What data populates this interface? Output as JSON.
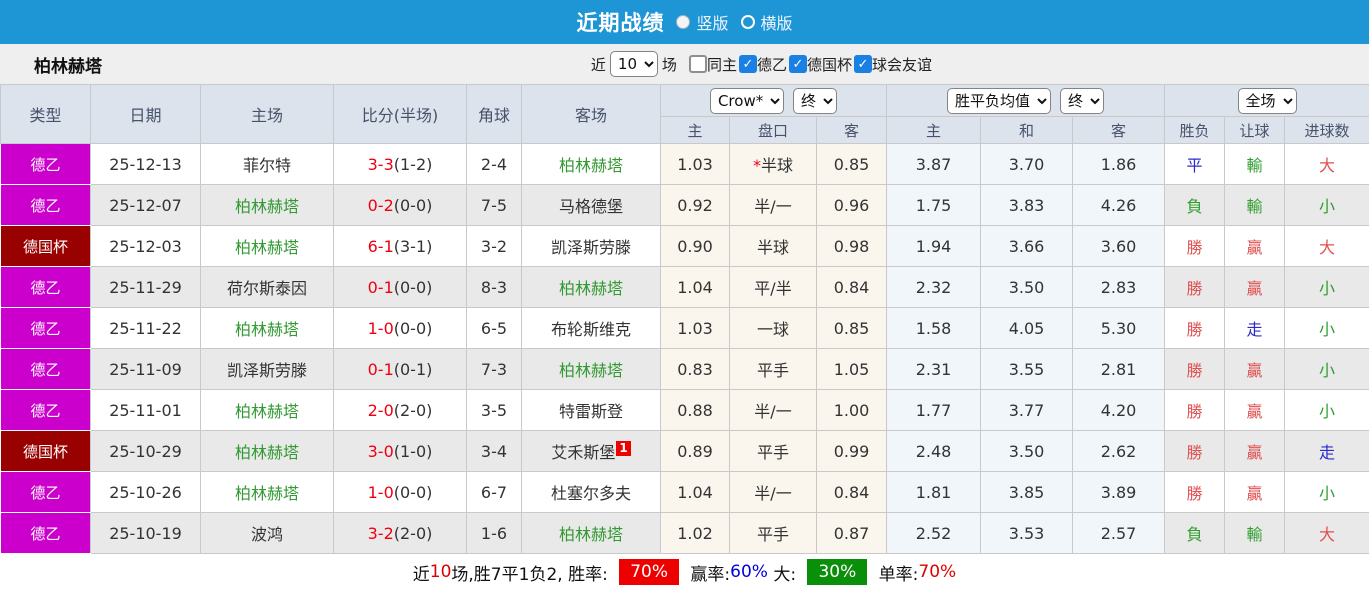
{
  "header": {
    "title": "近期战绩",
    "vertical_label": "竖版",
    "horizontal_label": "横版",
    "selected_layout": "竖版"
  },
  "filters": {
    "team_name": "柏林赫塔",
    "near_label": "近",
    "count": "10",
    "games_label": "场",
    "checkboxes": [
      {
        "label": "同主",
        "checked": false
      },
      {
        "label": "德乙",
        "checked": true
      },
      {
        "label": "德国杯",
        "checked": true
      },
      {
        "label": "球会友谊",
        "checked": true
      }
    ]
  },
  "table": {
    "columns": [
      "类型",
      "日期",
      "主场",
      "比分(半场)",
      "角球",
      "客场"
    ],
    "group1": {
      "select1": "Crow*",
      "select2": "终",
      "subs": [
        "主",
        "盘口",
        "客"
      ]
    },
    "group2": {
      "select1": "胜平负均值",
      "select2": "终",
      "subs": [
        "主",
        "和",
        "客"
      ]
    },
    "group3": {
      "select1": "全场",
      "subs": [
        "胜负",
        "让球",
        "进球数"
      ]
    }
  },
  "palette": {
    "title_bar_blue": "#1e95d5",
    "league_l2_magenta": "#cc00cc",
    "league_cup_dark_red": "#990000",
    "focus_team_green": "#339933",
    "score_red": "#ee0011",
    "result_red": "#e05050",
    "result_blue": "#2b2bcc",
    "result_green": "#2f9e2f",
    "checkbox_blue": "#1b80e4",
    "box_red": "#ee0000",
    "box_green": "#0a8f0a"
  },
  "rows": [
    {
      "league": "德乙",
      "league_type": "l2",
      "date": "25-12-13",
      "home": "菲尔特",
      "home_focus": false,
      "ft": "3-3",
      "ht": "(1-2)",
      "corner": "2-4",
      "away": "柏林赫塔",
      "away_focus": true,
      "away_badge": "",
      "odds": [
        "1.03",
        "*半球",
        "0.85"
      ],
      "avg": [
        "3.87",
        "3.70",
        "1.86"
      ],
      "result": [
        "平",
        "blue"
      ],
      "handicap": [
        "輸",
        "green"
      ],
      "goals": [
        "大",
        "red"
      ]
    },
    {
      "league": "德乙",
      "league_type": "l2",
      "date": "25-12-07",
      "home": "柏林赫塔",
      "home_focus": true,
      "ft": "0-2",
      "ht": "(0-0)",
      "corner": "7-5",
      "away": "马格德堡",
      "away_focus": false,
      "away_badge": "",
      "odds": [
        "0.92",
        "半/一",
        "0.96"
      ],
      "avg": [
        "1.75",
        "3.83",
        "4.26"
      ],
      "result": [
        "負",
        "green"
      ],
      "handicap": [
        "輸",
        "green"
      ],
      "goals": [
        "小",
        "green"
      ]
    },
    {
      "league": "德国杯",
      "league_type": "cup",
      "date": "25-12-03",
      "home": "柏林赫塔",
      "home_focus": true,
      "ft": "6-1",
      "ht": "(3-1)",
      "corner": "3-2",
      "away": "凯泽斯劳滕",
      "away_focus": false,
      "away_badge": "",
      "odds": [
        "0.90",
        "半球",
        "0.98"
      ],
      "avg": [
        "1.94",
        "3.66",
        "3.60"
      ],
      "result": [
        "勝",
        "red"
      ],
      "handicap": [
        "贏",
        "red"
      ],
      "goals": [
        "大",
        "red"
      ]
    },
    {
      "league": "德乙",
      "league_type": "l2",
      "date": "25-11-29",
      "home": "荷尔斯泰因",
      "home_focus": false,
      "ft": "0-1",
      "ht": "(0-0)",
      "corner": "8-3",
      "away": "柏林赫塔",
      "away_focus": true,
      "away_badge": "",
      "odds": [
        "1.04",
        "平/半",
        "0.84"
      ],
      "avg": [
        "2.32",
        "3.50",
        "2.83"
      ],
      "result": [
        "勝",
        "red"
      ],
      "handicap": [
        "贏",
        "red"
      ],
      "goals": [
        "小",
        "green"
      ]
    },
    {
      "league": "德乙",
      "league_type": "l2",
      "date": "25-11-22",
      "home": "柏林赫塔",
      "home_focus": true,
      "ft": "1-0",
      "ht": "(0-0)",
      "corner": "6-5",
      "away": "布轮斯维克",
      "away_focus": false,
      "away_badge": "",
      "odds": [
        "1.03",
        "一球",
        "0.85"
      ],
      "avg": [
        "1.58",
        "4.05",
        "5.30"
      ],
      "result": [
        "勝",
        "red"
      ],
      "handicap": [
        "走",
        "blue"
      ],
      "goals": [
        "小",
        "green"
      ]
    },
    {
      "league": "德乙",
      "league_type": "l2",
      "date": "25-11-09",
      "home": "凯泽斯劳滕",
      "home_focus": false,
      "ft": "0-1",
      "ht": "(0-1)",
      "corner": "7-3",
      "away": "柏林赫塔",
      "away_focus": true,
      "away_badge": "",
      "odds": [
        "0.83",
        "平手",
        "1.05"
      ],
      "avg": [
        "2.31",
        "3.55",
        "2.81"
      ],
      "result": [
        "勝",
        "red"
      ],
      "handicap": [
        "贏",
        "red"
      ],
      "goals": [
        "小",
        "green"
      ]
    },
    {
      "league": "德乙",
      "league_type": "l2",
      "date": "25-11-01",
      "home": "柏林赫塔",
      "home_focus": true,
      "ft": "2-0",
      "ht": "(2-0)",
      "corner": "3-5",
      "away": "特雷斯登",
      "away_focus": false,
      "away_badge": "",
      "odds": [
        "0.88",
        "半/一",
        "1.00"
      ],
      "avg": [
        "1.77",
        "3.77",
        "4.20"
      ],
      "result": [
        "勝",
        "red"
      ],
      "handicap": [
        "贏",
        "red"
      ],
      "goals": [
        "小",
        "green"
      ]
    },
    {
      "league": "德国杯",
      "league_type": "cup",
      "date": "25-10-29",
      "home": "柏林赫塔",
      "home_focus": true,
      "ft": "3-0",
      "ht": "(1-0)",
      "corner": "3-4",
      "away": "艾禾斯堡",
      "away_focus": false,
      "away_badge": "1",
      "odds": [
        "0.89",
        "平手",
        "0.99"
      ],
      "avg": [
        "2.48",
        "3.50",
        "2.62"
      ],
      "result": [
        "勝",
        "red"
      ],
      "handicap": [
        "贏",
        "red"
      ],
      "goals": [
        "走",
        "blue"
      ]
    },
    {
      "league": "德乙",
      "league_type": "l2",
      "date": "25-10-26",
      "home": "柏林赫塔",
      "home_focus": true,
      "ft": "1-0",
      "ht": "(0-0)",
      "corner": "6-7",
      "away": "杜塞尔多夫",
      "away_focus": false,
      "away_badge": "",
      "odds": [
        "1.04",
        "半/一",
        "0.84"
      ],
      "avg": [
        "1.81",
        "3.85",
        "3.89"
      ],
      "result": [
        "勝",
        "red"
      ],
      "handicap": [
        "贏",
        "red"
      ],
      "goals": [
        "小",
        "green"
      ]
    },
    {
      "league": "德乙",
      "league_type": "l2",
      "date": "25-10-19",
      "home": "波鸿",
      "home_focus": false,
      "ft": "3-2",
      "ht": "(2-0)",
      "corner": "1-6",
      "away": "柏林赫塔",
      "away_focus": true,
      "away_badge": "",
      "odds": [
        "1.02",
        "平手",
        "0.87"
      ],
      "avg": [
        "2.52",
        "3.53",
        "2.57"
      ],
      "result": [
        "負",
        "green"
      ],
      "handicap": [
        "輸",
        "green"
      ],
      "goals": [
        "大",
        "red"
      ]
    }
  ],
  "footer": {
    "segments": [
      {
        "text": "近",
        "style": "plain"
      },
      {
        "text": "10",
        "style": "red"
      },
      {
        "text": "场,胜7平1负2, 胜率: ",
        "style": "plain"
      },
      {
        "text": "70%",
        "style": "box-red"
      },
      {
        "text": " 赢率:",
        "style": "plain"
      },
      {
        "text": "60%",
        "style": "blue"
      },
      {
        "text": " 大: ",
        "style": "plain"
      },
      {
        "text": "30%",
        "style": "box-green"
      },
      {
        "text": " 单率:",
        "style": "plain"
      },
      {
        "text": "70%",
        "style": "red"
      }
    ]
  }
}
